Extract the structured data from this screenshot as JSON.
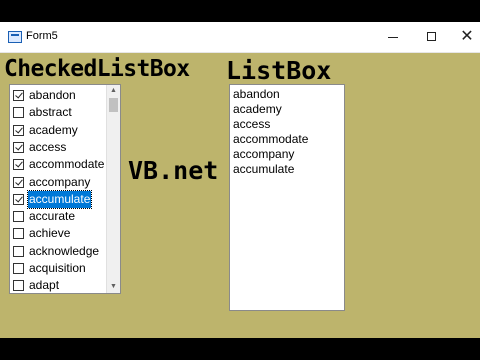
{
  "window": {
    "title": "Form5",
    "minimize_glyph": "",
    "maximize_glyph": "",
    "close_glyph": "✕",
    "background_color": "#bdb46c"
  },
  "headings": {
    "checked_list_box": "CheckedListBox",
    "list_box": "ListBox",
    "center_label": "VB.net"
  },
  "checked_list_box": {
    "items": [
      {
        "label": "abandon",
        "checked": true
      },
      {
        "label": "abstract",
        "checked": false
      },
      {
        "label": "academy",
        "checked": true
      },
      {
        "label": "access",
        "checked": true
      },
      {
        "label": "accommodate",
        "checked": true
      },
      {
        "label": "accompany",
        "checked": true
      },
      {
        "label": "accumulate",
        "checked": true,
        "selected": true
      },
      {
        "label": "accurate",
        "checked": false
      },
      {
        "label": "achieve",
        "checked": false
      },
      {
        "label": "acknowledge",
        "checked": false
      },
      {
        "label": "acquisition",
        "checked": false
      },
      {
        "label": "adapt",
        "checked": false
      }
    ],
    "selection_color": "#0078d7",
    "scroll_up_glyph": "▲",
    "scroll_down_glyph": "▼"
  },
  "list_box": {
    "items": [
      "abandon",
      "academy",
      "access",
      "accommodate",
      "accompany",
      "accumulate"
    ]
  }
}
